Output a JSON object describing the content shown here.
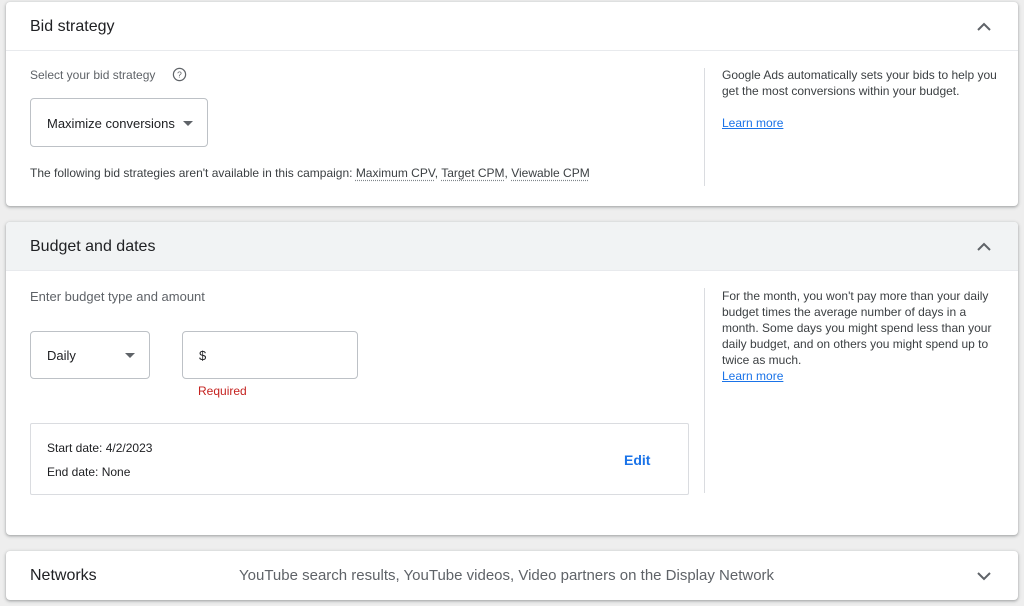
{
  "bid_strategy": {
    "title": "Bid strategy",
    "select_label": "Select your bid strategy",
    "selected_value": "Maximize conversions",
    "unavailable_prefix": "The following bid strategies aren't available in this campaign: ",
    "unavailable": [
      "Maximum CPV",
      "Target CPM",
      "Viewable CPM"
    ],
    "help_text": "Google Ads automatically sets your bids to help you get the most conversions within your budget.",
    "learn_more": "Learn more",
    "icons": {
      "help": "help-circle-icon",
      "collapse": "chevron-up-icon",
      "dropdown": "caret-down-icon"
    }
  },
  "budget": {
    "title": "Budget and dates",
    "label": "Enter budget type and amount",
    "type_value": "Daily",
    "currency_symbol": "$",
    "amount_value": "",
    "required_text": "Required",
    "start_date": "Start date: 4/2/2023",
    "end_date": "End date: None",
    "edit_label": "Edit",
    "help_text": "For the month, you won't pay more than your daily budget times the average number of days in a month. Some days you might spend less than your daily budget, and on others you might spend up to twice as much.",
    "learn_more": "Learn more",
    "icons": {
      "collapse": "chevron-up-icon",
      "dropdown": "caret-down-icon"
    }
  },
  "networks": {
    "title": "Networks",
    "summary": "YouTube search results, YouTube videos, Video partners on the Display Network",
    "icons": {
      "expand": "chevron-down-icon"
    }
  },
  "colors": {
    "link": "#1a73e8",
    "error": "#c5221f",
    "header_active": "#f1f3f4"
  }
}
